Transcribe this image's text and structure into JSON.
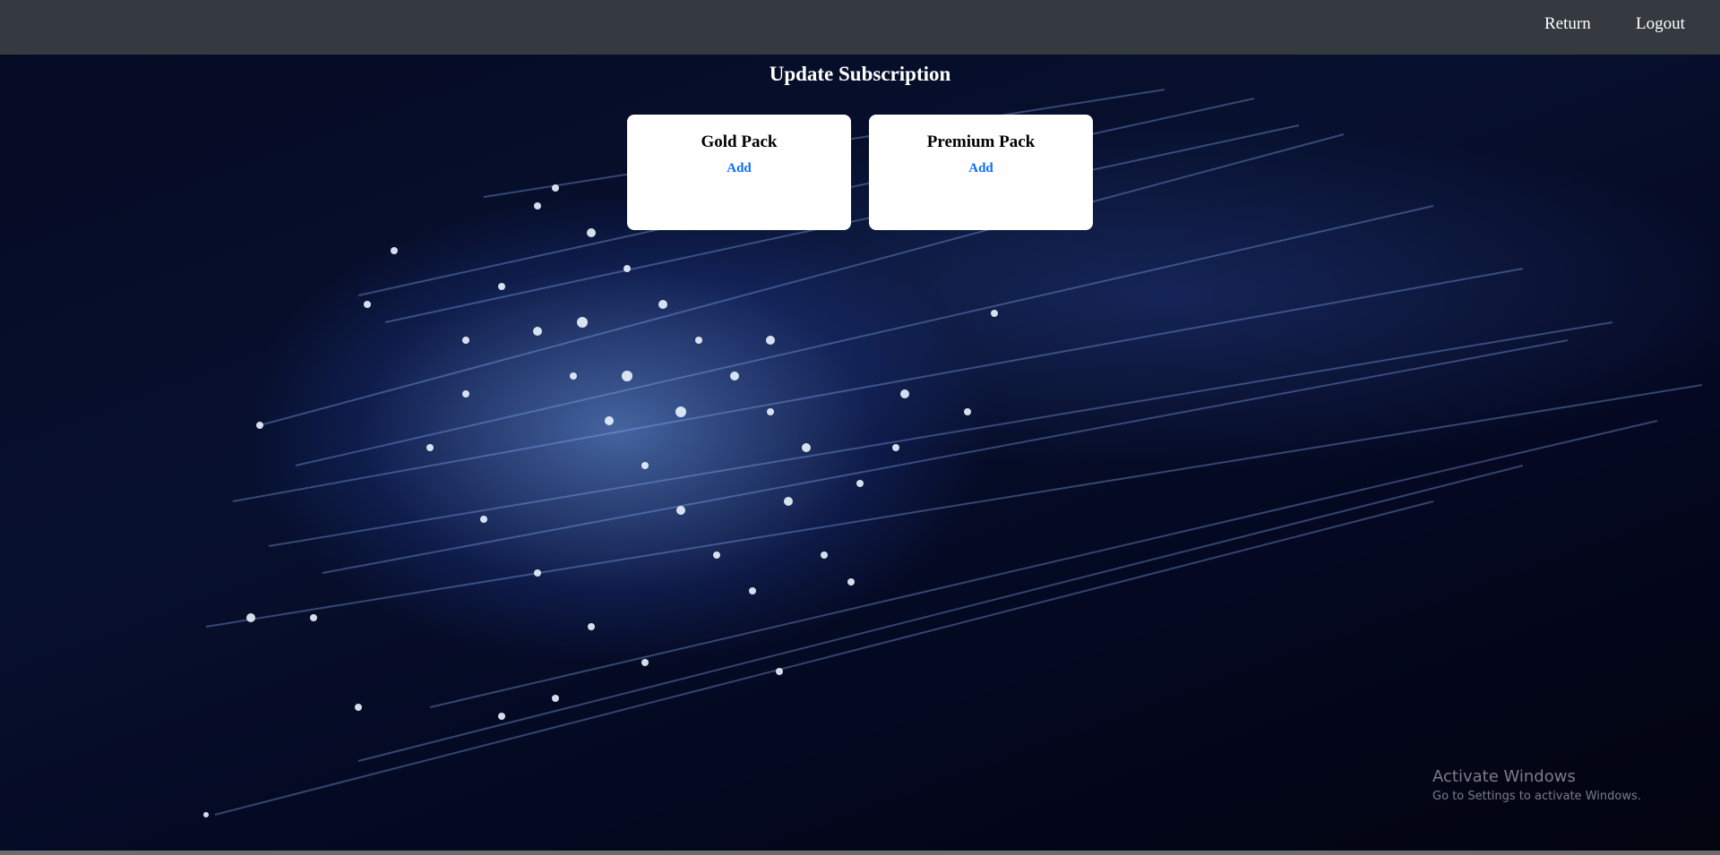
{
  "navbar": {
    "return_label": "Return",
    "logout_label": "Logout",
    "bg_color": "#343a40"
  },
  "page": {
    "title": "Update Subscription"
  },
  "packs": [
    {
      "name": "Gold Pack",
      "action_label": "Add"
    },
    {
      "name": "Premium Pack",
      "action_label": "Add"
    }
  ],
  "watermark": {
    "line1": "Activate Windows",
    "line2": "Go to Settings to activate Windows."
  },
  "colors": {
    "link": "#0d6efd",
    "card_bg": "#ffffff"
  }
}
